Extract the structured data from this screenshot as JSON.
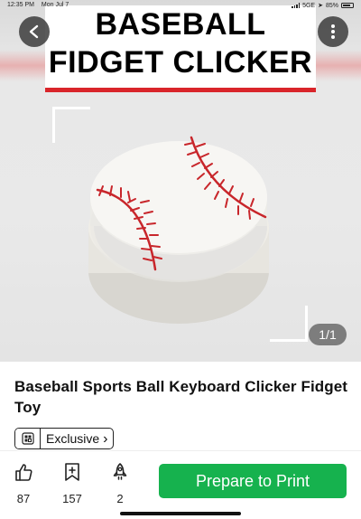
{
  "status_bar": {
    "time": "12:35 PM",
    "date": "Mon Jul 7",
    "network": "5GE",
    "battery": "85%"
  },
  "hero": {
    "title_line1": "BASEBALL",
    "title_line2": "FIDGET CLICKER",
    "image_counter": "1/1",
    "accent_color": "#d9252a"
  },
  "product": {
    "title": "Baseball Sports Ball Keyboard Clicker Fidget Toy",
    "badge_label": "Exclusive",
    "badge_chevron": "›"
  },
  "actions": {
    "likes": "87",
    "saves": "157",
    "boosts": "2",
    "print_label": "Prepare to Print",
    "print_color": "#16b24e"
  }
}
